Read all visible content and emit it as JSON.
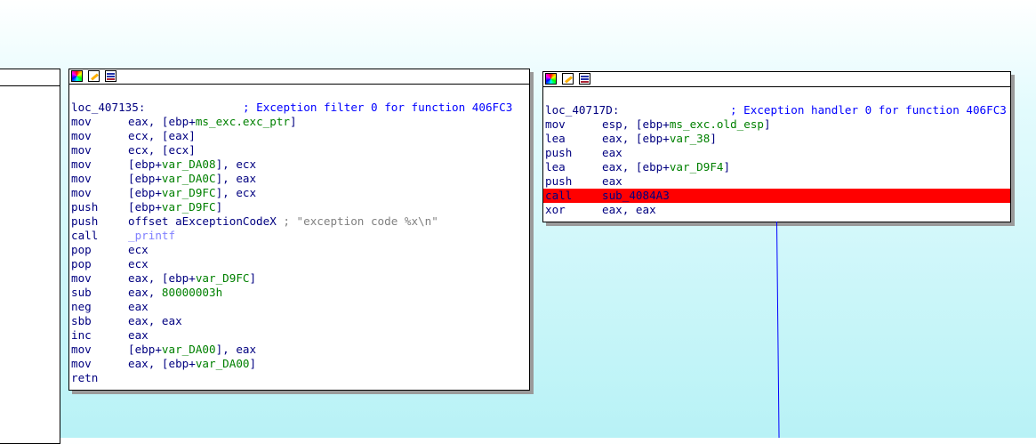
{
  "left_node": {},
  "node1": {
    "lines": [
      {
        "type": "label",
        "label": "loc_407135:",
        "comment": "; Exception filter 0 for function 406FC3"
      },
      {
        "mn": "mov",
        "op": [
          [
            "eax, [ebp+",
            ""
          ],
          [
            "ms_exc.exc_ptr",
            "var"
          ],
          [
            "]",
            ""
          ]
        ]
      },
      {
        "mn": "mov",
        "op": [
          [
            "ecx, [eax]",
            ""
          ]
        ]
      },
      {
        "mn": "mov",
        "op": [
          [
            "ecx, [ecx]",
            ""
          ]
        ]
      },
      {
        "mn": "mov",
        "op": [
          [
            "[ebp+",
            ""
          ],
          [
            "var_DA08",
            "var"
          ],
          [
            "], ecx",
            ""
          ]
        ]
      },
      {
        "mn": "mov",
        "op": [
          [
            "[ebp+",
            ""
          ],
          [
            "var_DA0C",
            "var"
          ],
          [
            "], eax",
            ""
          ]
        ]
      },
      {
        "mn": "mov",
        "op": [
          [
            "[ebp+",
            ""
          ],
          [
            "var_D9FC",
            "var"
          ],
          [
            "], ecx",
            ""
          ]
        ]
      },
      {
        "mn": "push",
        "op": [
          [
            "[ebp+",
            ""
          ],
          [
            "var_D9FC",
            "var"
          ],
          [
            "]",
            ""
          ]
        ]
      },
      {
        "mn": "push",
        "op": [
          [
            "offset aExceptionCodeX ",
            ""
          ],
          [
            "; \"exception code %x\\n\"",
            "grey"
          ]
        ]
      },
      {
        "mn": "call",
        "op": [
          [
            "_printf",
            "fn"
          ]
        ]
      },
      {
        "mn": "pop",
        "op": [
          [
            "ecx",
            ""
          ]
        ]
      },
      {
        "mn": "pop",
        "op": [
          [
            "ecx",
            ""
          ]
        ]
      },
      {
        "mn": "mov",
        "op": [
          [
            "eax, [ebp+",
            ""
          ],
          [
            "var_D9FC",
            "var"
          ],
          [
            "]",
            ""
          ]
        ]
      },
      {
        "mn": "sub",
        "op": [
          [
            "eax, ",
            ""
          ],
          [
            "80000003h",
            "num"
          ]
        ]
      },
      {
        "mn": "neg",
        "op": [
          [
            "eax",
            ""
          ]
        ]
      },
      {
        "mn": "sbb",
        "op": [
          [
            "eax, eax",
            ""
          ]
        ]
      },
      {
        "mn": "inc",
        "op": [
          [
            "eax",
            ""
          ]
        ]
      },
      {
        "mn": "mov",
        "op": [
          [
            "[ebp+",
            ""
          ],
          [
            "var_DA00",
            "var"
          ],
          [
            "], eax",
            ""
          ]
        ]
      },
      {
        "mn": "mov",
        "op": [
          [
            "eax, [ebp+",
            ""
          ],
          [
            "var_DA00",
            "var"
          ],
          [
            "]",
            ""
          ]
        ]
      },
      {
        "mn": "retn",
        "op": []
      }
    ]
  },
  "node2": {
    "lines": [
      {
        "type": "label",
        "label": "loc_40717D:",
        "comment": "; Exception handler 0 for function 406FC3"
      },
      {
        "mn": "mov",
        "op": [
          [
            "esp, [ebp+",
            ""
          ],
          [
            "ms_exc.old_esp",
            "var"
          ],
          [
            "]",
            ""
          ]
        ]
      },
      {
        "mn": "lea",
        "op": [
          [
            "eax, [ebp+",
            ""
          ],
          [
            "var_38",
            "var"
          ],
          [
            "]",
            ""
          ]
        ]
      },
      {
        "mn": "push",
        "op": [
          [
            "eax",
            ""
          ]
        ]
      },
      {
        "mn": "lea",
        "op": [
          [
            "eax, [ebp+",
            ""
          ],
          [
            "var_D9F4",
            "var"
          ],
          [
            "]",
            ""
          ]
        ]
      },
      {
        "mn": "push",
        "op": [
          [
            "eax",
            ""
          ]
        ]
      },
      {
        "mn": "call",
        "op": [
          [
            "sub_4084A3",
            ""
          ]
        ],
        "highlight": true
      },
      {
        "mn": "xor",
        "op": [
          [
            "eax, eax",
            ""
          ]
        ]
      }
    ]
  },
  "colors": {
    "highlight": "#ff0000",
    "edge": "#0000ff",
    "variable": "#008000",
    "comment": "#0000ff",
    "code": "#000080"
  }
}
